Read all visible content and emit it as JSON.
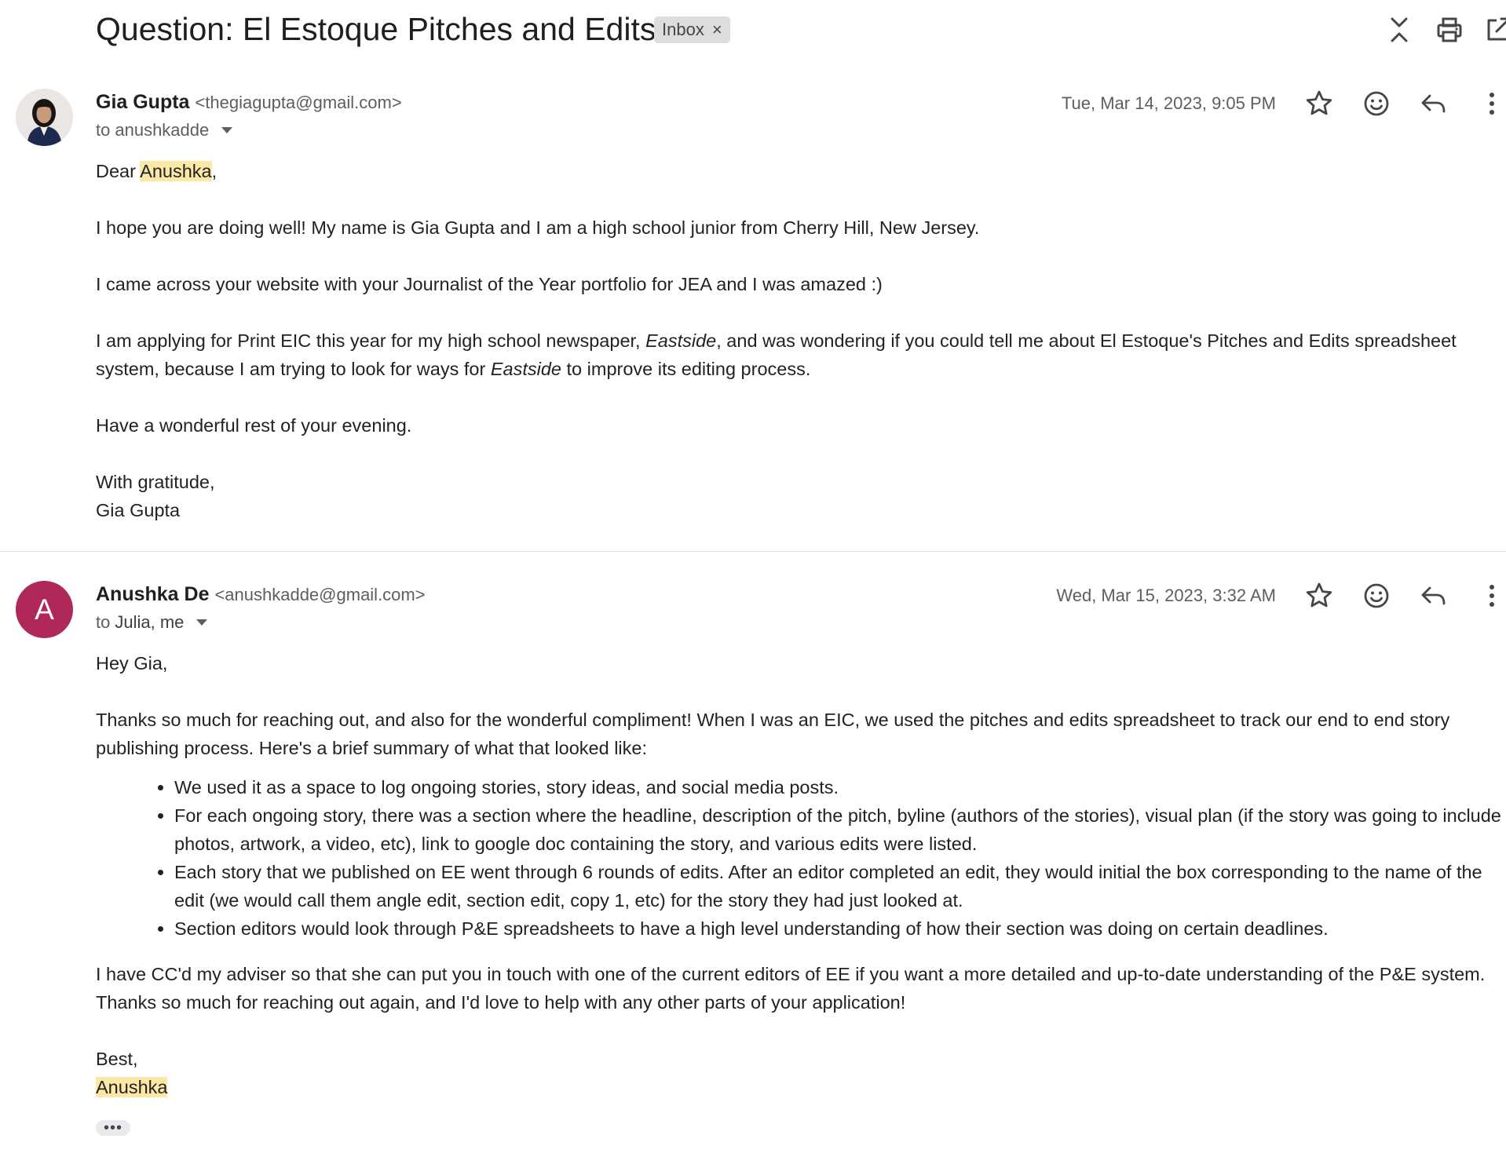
{
  "thread": {
    "subject": "Question: El Estoque Pitches and Edits",
    "label": "Inbox",
    "label_remove": "×"
  },
  "header_icons": [
    "collapse-all-icon",
    "print-icon",
    "open-in-new-window-icon"
  ],
  "messages": [
    {
      "sender_name": "Gia Gupta",
      "sender_email": "<thegiagupta@gmail.com>",
      "to_prefix": "to",
      "recipients": "anushkadde",
      "date": "Tue, Mar 14, 2023, 9:05 PM",
      "greeting_pre": "Dear ",
      "greeting_name": "Anushka",
      "greeting_post": ",",
      "p1": "I hope you are doing well! My name is Gia Gupta and I am a high school junior from Cherry Hill, New Jersey.",
      "p2": "I came across your website with your Journalist of the Year portfolio for JEA and I was amazed :)",
      "p3_a": "I am applying for Print EIC this year for my high school newspaper, ",
      "p3_em1": "Eastside",
      "p3_b": ", and was wondering if you could tell me about El Estoque's Pitches and Edits spreadsheet system, because I am trying to look for ways for ",
      "p3_em2": "Eastside",
      "p3_c": " to improve its editing process.",
      "p4": "Have a wonderful rest of your evening.",
      "closing": "With gratitude,",
      "signature": "Gia Gupta"
    },
    {
      "avatar_letter": "A",
      "avatar_color": "#b0285a",
      "sender_name": "Anushka De",
      "sender_email": "<anushkadde@gmail.com>",
      "to_prefix": "to",
      "recipients": "Julia, me",
      "date": "Wed, Mar 15, 2023, 3:32 AM",
      "greeting": "Hey Gia,",
      "p1": "Thanks so much for reaching out, and also for the wonderful compliment! When I was an EIC, we used the pitches and edits spreadsheet to track our end to end story publishing process. Here's a brief summary of what that looked like:",
      "bullets": [
        "We used it as a space to log ongoing stories, story ideas, and social media posts.",
        "For each ongoing story, there was a section where the headline, description of the pitch, byline (authors of the stories), visual plan (if the story was going to include photos, artwork, a video, etc), link to google doc containing the story, and various edits were listed.",
        "Each story that we published on EE went through 6 rounds of edits. After an editor completed an edit, they would initial the box corresponding to the name of the edit (we would call them angle edit, section edit, copy 1, etc) for the story they had just looked at.",
        "Section editors would look through P&E spreadsheets to have a high level understanding of how their section was doing on certain deadlines."
      ],
      "p2": "I have CC'd my adviser so that she can put you in touch with one of the current editors of EE if you want a more detailed and up-to-date understanding of the P&E system. Thanks so much for reaching out again, and I'd love to help with any other parts of your application!",
      "closing": "Best,",
      "signature": "Anushka",
      "trimmed_content": "•••"
    }
  ]
}
